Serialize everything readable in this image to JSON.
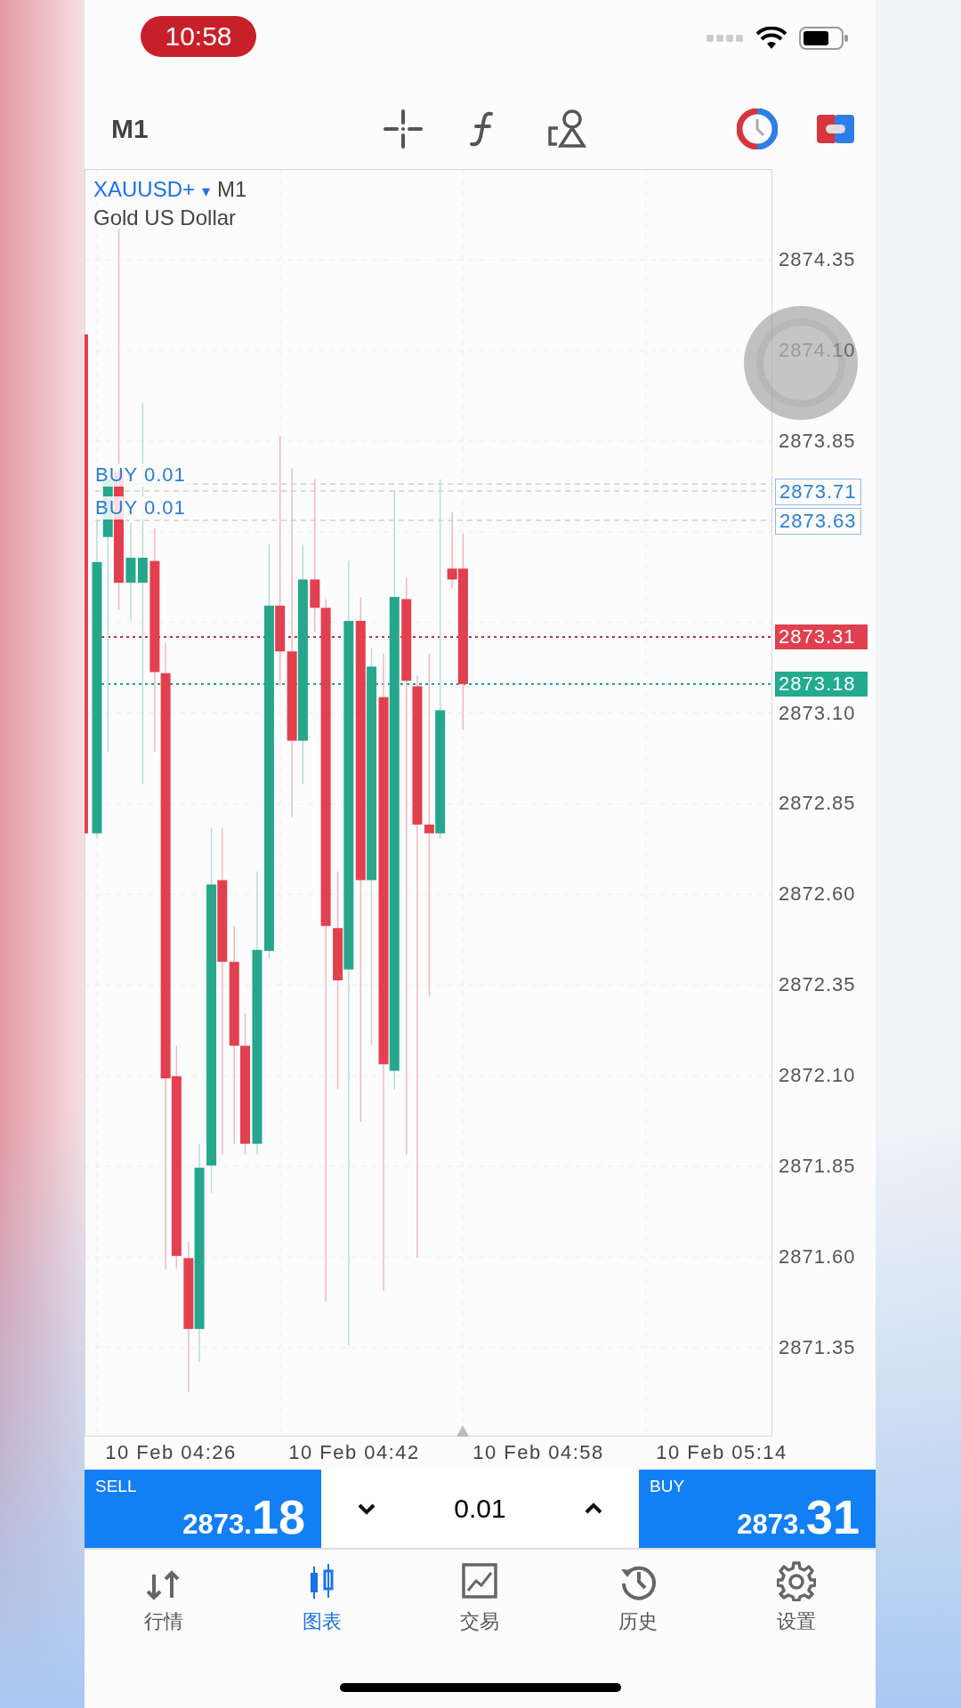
{
  "status_bar": {
    "time": "10:58"
  },
  "toolbar": {
    "timeframe": "M1"
  },
  "chart": {
    "symbol": "XAUUSD+",
    "symbol_caret": "▾",
    "timeframe": "M1",
    "description": "Gold US Dollar",
    "price_ticks": [
      "2874.35",
      "2874.10",
      "2873.85",
      "2873.10",
      "2872.85",
      "2872.60",
      "2872.35",
      "2872.10",
      "2871.85",
      "2871.60",
      "2871.35"
    ],
    "order_lines": [
      {
        "label": "BUY 0.01",
        "price": "2873.71"
      },
      {
        "label": "BUY 0.01",
        "price": "2873.63"
      }
    ],
    "ask_price": "2873.31",
    "bid_price": "2873.18",
    "time_labels": [
      "10 Feb 04:26",
      "10 Feb 04:42",
      "10 Feb 04:58",
      "10 Feb 05:14"
    ]
  },
  "trade_bar": {
    "sell": {
      "label": "SELL",
      "price_head": "2873.",
      "price_tail": "18"
    },
    "volume": "0.01",
    "buy": {
      "label": "BUY",
      "price_head": "2873.",
      "price_tail": "31"
    }
  },
  "tabs": [
    {
      "label": "行情",
      "selected": false
    },
    {
      "label": "图表",
      "selected": true
    },
    {
      "label": "交易",
      "selected": false
    },
    {
      "label": "历史",
      "selected": false
    },
    {
      "label": "设置",
      "selected": false
    }
  ]
}
